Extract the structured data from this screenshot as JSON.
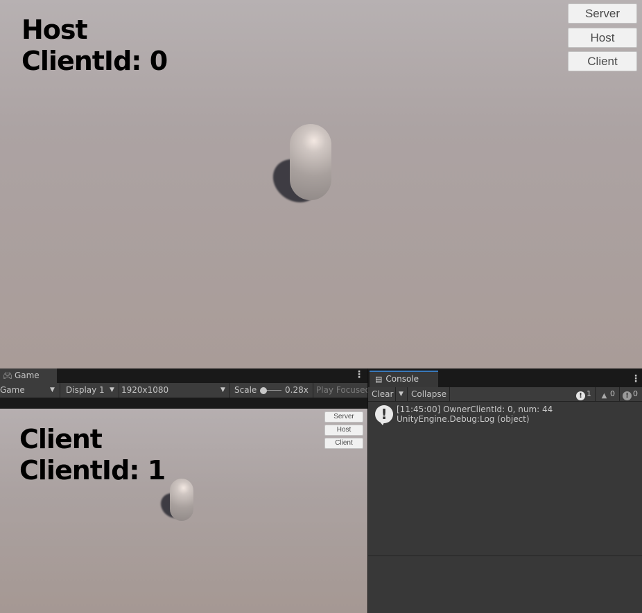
{
  "host_view": {
    "role": "Host",
    "client_id_text": "ClientId: 0",
    "buttons": {
      "server": "Server",
      "host": "Host",
      "client": "Client"
    }
  },
  "game_panel": {
    "tab_icon": "gamepad-icon",
    "tab_label": "Game",
    "toolbar": {
      "view_mode": "Game",
      "display": "Display 1",
      "resolution": "1920x1080",
      "scale_label": "Scale",
      "scale_value": "0.28x",
      "play_mode": "Play Focused"
    },
    "client_view": {
      "role": "Client",
      "client_id_text": "ClientId: 1",
      "buttons": {
        "server": "Server",
        "host": "Host",
        "client": "Client"
      }
    }
  },
  "console_panel": {
    "tab_icon": "list-icon",
    "tab_label": "Console",
    "toolbar": {
      "clear": "Clear",
      "collapse": "Collapse",
      "info_count": "1",
      "warning_count": "0",
      "error_count": "0"
    },
    "entries": [
      {
        "icon": "info-icon",
        "message": "[11:45:00] OwnerClientId: 0, num: 44",
        "stack": "UnityEngine.Debug:Log (object)"
      }
    ]
  },
  "colors": {
    "accent_tab": "#3a79bb",
    "panel_bg": "#383838",
    "toolbar_bg": "#3c3c3c"
  }
}
